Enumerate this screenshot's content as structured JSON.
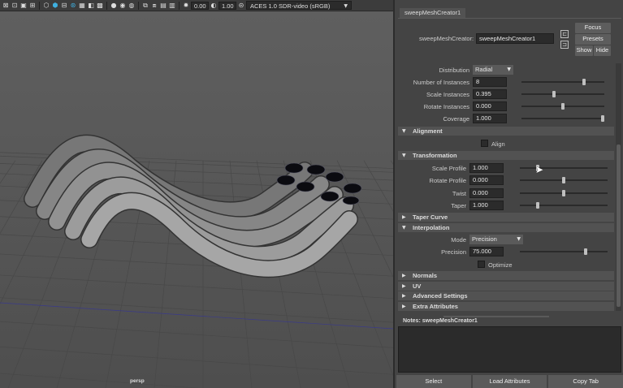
{
  "toolbar": {
    "icons": [
      "grid-icon",
      "camera-icon",
      "select-icon",
      "frame-icon",
      "wire-icon",
      "shaded-icon",
      "textured-icon",
      "light-icon",
      "shadow-icon",
      "ao-icon",
      "aa-icon",
      "isolate-icon",
      "xray-icon",
      "xray-joint-icon",
      "xray-active-icon",
      "exposure-icon",
      "gamma-icon"
    ],
    "exposure_value": "0.00",
    "gamma_value": "1.00",
    "color_space": "ACES 1.0 SDR-video (sRGB)"
  },
  "viewport": {
    "camera_label": "persp"
  },
  "attribute_editor": {
    "tab_label": "sweepMeshCreator1",
    "node_label": "sweepMeshCreator:",
    "node_name": "sweepMeshCreator1",
    "focus_label": "Focus",
    "presets_label": "Presets",
    "show_label": "Show",
    "hide_label": "Hide",
    "rows": {
      "distribution": {
        "label": "Distribution",
        "value": "Radial"
      },
      "num_instances": {
        "label": "Number of Instances",
        "value": "8",
        "level": 0.75
      },
      "scale_instances": {
        "label": "Scale Instances",
        "value": "0.395",
        "level": 0.39
      },
      "rotate_instances": {
        "label": "Rotate Instances",
        "value": "0.000",
        "level": 0.5
      },
      "coverage": {
        "label": "Coverage",
        "value": "1.000",
        "level": 1.0
      },
      "align": {
        "label": "Align"
      },
      "scale_profile": {
        "label": "Scale Profile",
        "value": "1.000",
        "level": 0.2
      },
      "rotate_profile": {
        "label": "Rotate Profile",
        "value": "0.000",
        "level": 0.5
      },
      "twist": {
        "label": "Twist",
        "value": "0.000",
        "level": 0.5
      },
      "taper": {
        "label": "Taper",
        "value": "1.000",
        "level": 0.2
      },
      "mode": {
        "label": "Mode",
        "value": "Precision"
      },
      "precision": {
        "label": "Precision",
        "value": "75.000",
        "level": 0.75
      },
      "optimize": {
        "label": "Optimize"
      }
    },
    "sections": {
      "alignment": "Alignment",
      "transformation": "Transformation",
      "taper_curve": "Taper Curve",
      "interpolation": "Interpolation",
      "normals": "Normals",
      "uv": "UV",
      "advanced": "Advanced Settings",
      "extra": "Extra Attributes"
    },
    "notes_label": "Notes:  sweepMeshCreator1",
    "bottom": {
      "select": "Select",
      "load": "Load Attributes",
      "copy": "Copy Tab"
    }
  }
}
